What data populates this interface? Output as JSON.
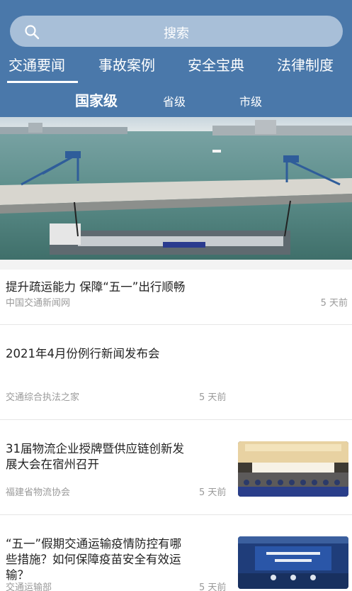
{
  "search": {
    "placeholder": "搜索"
  },
  "tabs": [
    "交通要闻",
    "事故案例",
    "安全宝典",
    "法律制度"
  ],
  "active_tab": "交通要闻",
  "levels": [
    "国家级",
    "省级",
    "市级"
  ],
  "active_level": "国家级",
  "news": [
    {
      "title": "提升疏运能力 保障“五一”出行顺畅",
      "source": "中国交通新闻网",
      "time": "5 天前"
    },
    {
      "title": "2021年4月份例行新闻发布会",
      "source": "交通综合执法之家",
      "time": "5 天前"
    },
    {
      "title": "31届物流企业授牌暨供应链创新发展大会在宿州召开",
      "title_lines": [
        "31届物流企业授牌暨供应链创新发",
        "展大会在宿州召开"
      ],
      "source": "福建省物流协会",
      "time": "5 天前"
    },
    {
      "title": "“五一”假期交通运输疫情防控有哪些措施？如何保障疫苗安全有效运输？",
      "title_lines": [
        "“五一”假期交通运输疫情防控有哪",
        "些措施？如何保障疫苗安全有效运",
        "输？"
      ],
      "source": "交通运输部",
      "time": "5 天前"
    }
  ],
  "colors": {
    "header": "#4a78aa",
    "search_bg": "#a8bfd8",
    "text": "#222222",
    "meta": "#9a9a9a"
  }
}
